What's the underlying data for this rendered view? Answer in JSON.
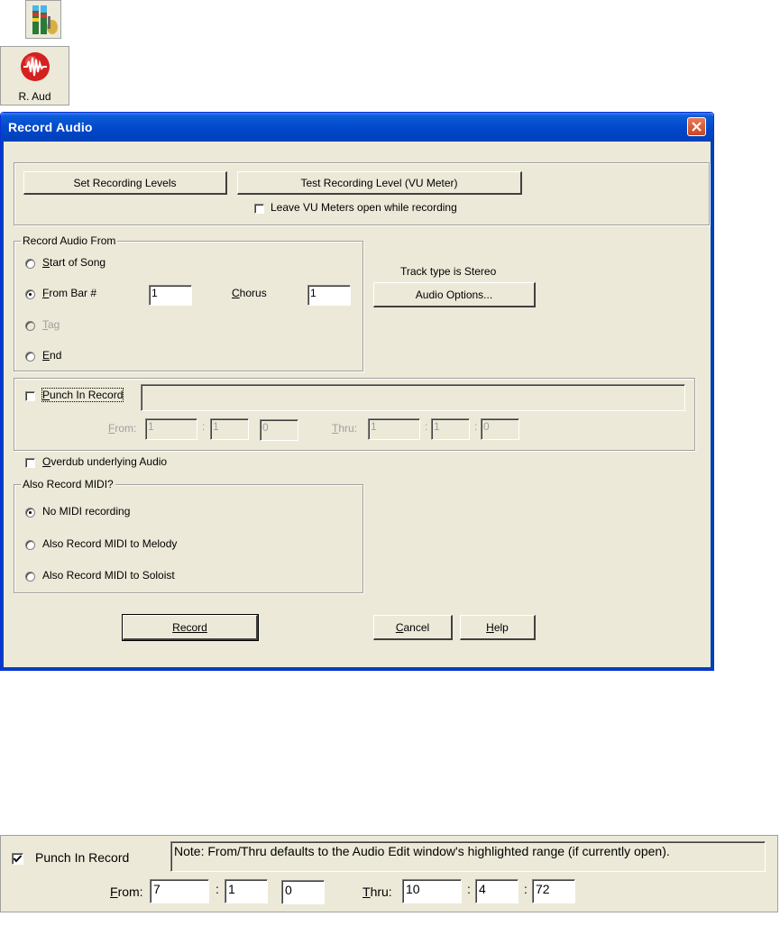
{
  "toolbar": {
    "mixer_icon": "mixer-icon",
    "record_audio_button_label": "R. Aud"
  },
  "dialog": {
    "title": "Record Audio",
    "set_levels_label": "Set Recording Levels",
    "test_level_label": "Test Recording Level (VU Meter)",
    "leave_vu_label": "Leave VU Meters open while recording",
    "record_from": {
      "legend": "Record Audio From",
      "start_of_song": "Start of Song",
      "from_bar": "From Bar #",
      "from_bar_value": "1",
      "chorus_label": "Chorus",
      "chorus_value": "1",
      "tag": "Tag",
      "end": "End",
      "selected": "From Bar #"
    },
    "track_type_text": "Track type is Stereo",
    "audio_options_label": "Audio Options...",
    "punch": {
      "label": "Punch In Record",
      "checked": false,
      "note": "",
      "from_label": "From:",
      "from": [
        "1",
        "1",
        "0"
      ],
      "thru_label": "Thru:",
      "thru": [
        "1",
        "1",
        "0"
      ]
    },
    "overdub_label": "Overdub underlying Audio",
    "midi": {
      "legend": "Also Record MIDI?",
      "options": [
        "No MIDI recording",
        "Also Record MIDI to Melody",
        "Also Record MIDI to Soloist"
      ],
      "selected": "No MIDI recording"
    },
    "record_label": "Record",
    "cancel_label": "Cancel",
    "help_label": "Help"
  },
  "punch_detail": {
    "label": "Punch In Record",
    "checked": true,
    "note": "Note:  From/Thru defaults to the Audio Edit window's highlighted range (if currently open).",
    "from_label": "From:",
    "from": [
      "7",
      "1",
      "0"
    ],
    "thru_label": "Thru:",
    "thru": [
      "10",
      "4",
      "72"
    ]
  },
  "colors": {
    "dialog_bg": "#ece9d8",
    "titlebar": "#0046c8",
    "close_button": "#c94522"
  }
}
